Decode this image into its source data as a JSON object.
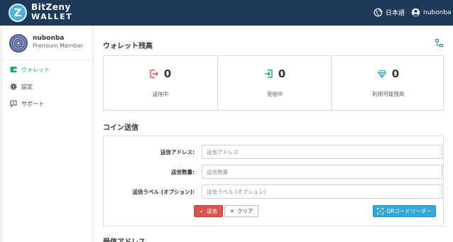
{
  "header": {
    "logo_letter": "Z",
    "brand_line1": "BitZeny",
    "brand_line2": "WALLET",
    "language": "日本語",
    "user": "nubonba",
    "colors": {
      "bar": "#1d3b59",
      "logo": "#4fb0d8"
    }
  },
  "sidebar": {
    "username": "nubonba",
    "role": "Premium Member",
    "items": [
      {
        "label": "ウォレット",
        "icon": "wallet-icon",
        "active": true
      },
      {
        "label": "設定",
        "icon": "gear-icon",
        "active": false
      },
      {
        "label": "サポート",
        "icon": "support-icon",
        "active": false
      }
    ],
    "active_color": "#1aa37a"
  },
  "balance": {
    "title": "ウォレット残高",
    "columns": [
      {
        "value": "0",
        "label": "送信中",
        "icon": "send-out-icon",
        "color": "#d9534f"
      },
      {
        "value": "0",
        "label": "受信中",
        "icon": "receive-in-icon",
        "color": "#1aa37a"
      },
      {
        "value": "0",
        "label": "利用可能残高",
        "icon": "diamond-icon",
        "color": "#31a8d8"
      }
    ]
  },
  "send": {
    "title": "コイン送信",
    "fields": [
      {
        "label": "送信アドレス:",
        "placeholder": "送信アドレス"
      },
      {
        "label": "送信数量:",
        "placeholder": "送信数量"
      },
      {
        "label": "送信ラベル (オプション):",
        "placeholder": "送信ラベル (オプション)"
      }
    ],
    "send_button": "送信",
    "clear_button": "クリア",
    "qr_button": "QRコードリーダー"
  },
  "receive": {
    "title": "受信アドレス"
  }
}
